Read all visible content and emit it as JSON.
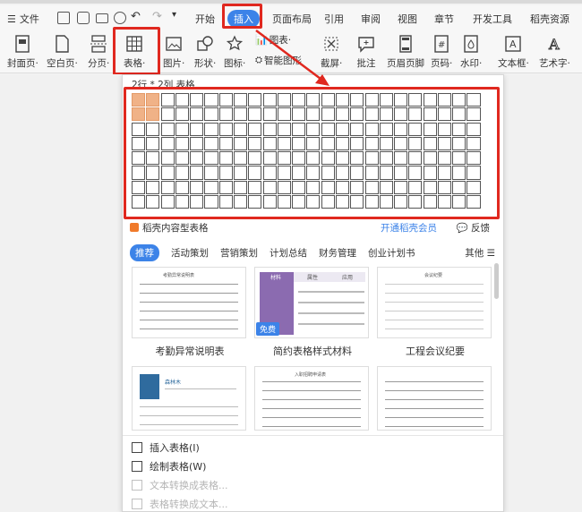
{
  "menu": {
    "file_label": "文件"
  },
  "tabs": [
    "开始",
    "插入",
    "页面布局",
    "引用",
    "审阅",
    "视图",
    "章节",
    "开发工具",
    "稻壳资源"
  ],
  "ribbon": [
    {
      "label": "封面页·"
    },
    {
      "label": "空白页·"
    },
    {
      "label": "分页·"
    },
    {
      "label": "表格·"
    },
    {
      "label": "图片·"
    },
    {
      "label": "形状·"
    },
    {
      "label": "图标·"
    },
    {
      "label": "图表·"
    },
    {
      "label": "智能图形"
    },
    {
      "label": "截屏·"
    },
    {
      "label": "批注"
    },
    {
      "label": "页眉页脚"
    },
    {
      "label": "页码·"
    },
    {
      "label": "水印·"
    },
    {
      "label": "文本框·"
    },
    {
      "label": "艺术字·"
    }
  ],
  "table_picker": {
    "label": "2行 * 2列 表格",
    "rows": 8,
    "cols": 24,
    "selected_rows": 2,
    "selected_cols": 2
  },
  "gallery": {
    "heading": "稻壳内容型表格",
    "vip_link": "开通稻壳会员",
    "feedback": "反馈",
    "categories": [
      "推荐",
      "活动策划",
      "营销策划",
      "计划总结",
      "财务管理",
      "创业计划书"
    ],
    "more": "其他 ☰",
    "templates": [
      {
        "caption": "考勤异常说明表"
      },
      {
        "caption": "简约表格样式材料",
        "badge": "免费"
      },
      {
        "caption": "工程会议纪要"
      }
    ],
    "preview_text": {
      "t1_title": "考勤异常说明表",
      "t2_col1": "材料",
      "t2_col2": "属性",
      "t2_col3": "应用",
      "t3_title": "会议纪要",
      "t4_name": "森林木",
      "t5_title": "入职招聘申请表"
    }
  },
  "bottom_menu": [
    {
      "label": "插入表格(I)",
      "enabled": true
    },
    {
      "label": "绘制表格(W)",
      "enabled": true
    },
    {
      "label": "文本转换成表格...",
      "enabled": false
    },
    {
      "label": "表格转换成文本...",
      "enabled": false
    }
  ],
  "colors": {
    "accent": "#3c83e8",
    "highlight": "#e0281f",
    "selected_cell": "#f0b287"
  }
}
